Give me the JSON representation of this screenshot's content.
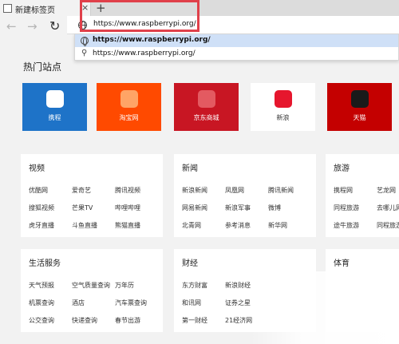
{
  "tab": {
    "title": "新建标签页",
    "close": "×",
    "new_tab": "+"
  },
  "nav": {
    "back": "←",
    "forward": "→",
    "refresh": "↻"
  },
  "address": {
    "value": "https://www.raspberrypi.org/"
  },
  "suggestions": [
    {
      "text": "https://www.raspberrypi.org/",
      "icon": "globe-icon"
    },
    {
      "text": "https://www.raspberrypi.org/",
      "icon": "search-icon",
      "glyph": "⚲"
    }
  ],
  "hot_sites": {
    "title": "热门站点",
    "tiles": [
      {
        "label": "携程",
        "bg": "#1e73c8",
        "icon_color": "#ffffff",
        "icon": "ctrip-icon"
      },
      {
        "label": "淘宝网",
        "bg": "#ff4a00",
        "icon_color": "#ffa466",
        "icon": "taobao-icon"
      },
      {
        "label": "京东商城",
        "bg": "#c81623",
        "icon_color": "#e35a61",
        "icon": "jd-icon"
      },
      {
        "label": "新浪",
        "bg": "#ffffff",
        "icon_color": "#e6162d",
        "icon": "weibo-icon"
      },
      {
        "label": "天猫",
        "bg": "#c40000",
        "icon_color": "#1a1a1a",
        "icon": "tmall-icon"
      }
    ]
  },
  "cards": {
    "video": {
      "title": "视频",
      "links": [
        "优酷网",
        "爱奇艺",
        "腾讯视频",
        "搜狐视频",
        "芒果TV",
        "哔哩哔哩",
        "虎牙直播",
        "斗鱼直播",
        "熊猫直播"
      ]
    },
    "news": {
      "title": "新闻",
      "links": [
        "新浪新闻",
        "凤凰网",
        "腾讯新闻",
        "网易新闻",
        "新浪军事",
        "微博",
        "北青网",
        "参考消息",
        "新华网"
      ]
    },
    "travel": {
      "title": "旅游",
      "links": [
        "携程网",
        "艺龙网",
        "同程旅游",
        "途牛旅游",
        "去哪儿网",
        "同程旅游"
      ]
    },
    "life": {
      "title": "生活服务",
      "links": [
        "天气预报",
        "空气质量查询",
        "万年历",
        "机票查询",
        "酒店",
        "汽车票查询",
        "公交查询",
        "快递查询",
        "春节出游"
      ]
    },
    "finance": {
      "title": "财经",
      "links": [
        "东方财富",
        "新浪财经",
        "和讯网",
        "证券之星",
        "第一财经",
        "21经济网"
      ]
    },
    "sports": {
      "title": "体育"
    }
  }
}
